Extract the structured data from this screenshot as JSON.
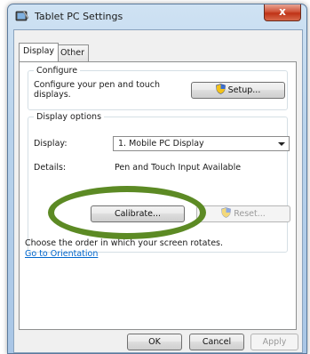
{
  "window": {
    "title": "Tablet PC Settings",
    "close_glyph": "x"
  },
  "tabs": [
    {
      "label": "Display",
      "active": true
    },
    {
      "label": "Other",
      "active": false
    }
  ],
  "configure": {
    "legend": "Configure",
    "description": "Configure your pen and touch displays.",
    "setup_button": "Setup..."
  },
  "display_options": {
    "legend": "Display options",
    "display_label": "Display:",
    "display_value": "1. Mobile PC Display",
    "details_label": "Details:",
    "details_value": "Pen and Touch Input Available",
    "calibrate_button": "Calibrate...",
    "reset_button": "Reset..."
  },
  "orientation": {
    "text": "Choose the order in which your screen rotates.",
    "link": "Go to Orientation"
  },
  "dialog_buttons": {
    "ok": "OK",
    "cancel": "Cancel",
    "apply": "Apply"
  },
  "annotation": {
    "color": "#5c8a24"
  }
}
